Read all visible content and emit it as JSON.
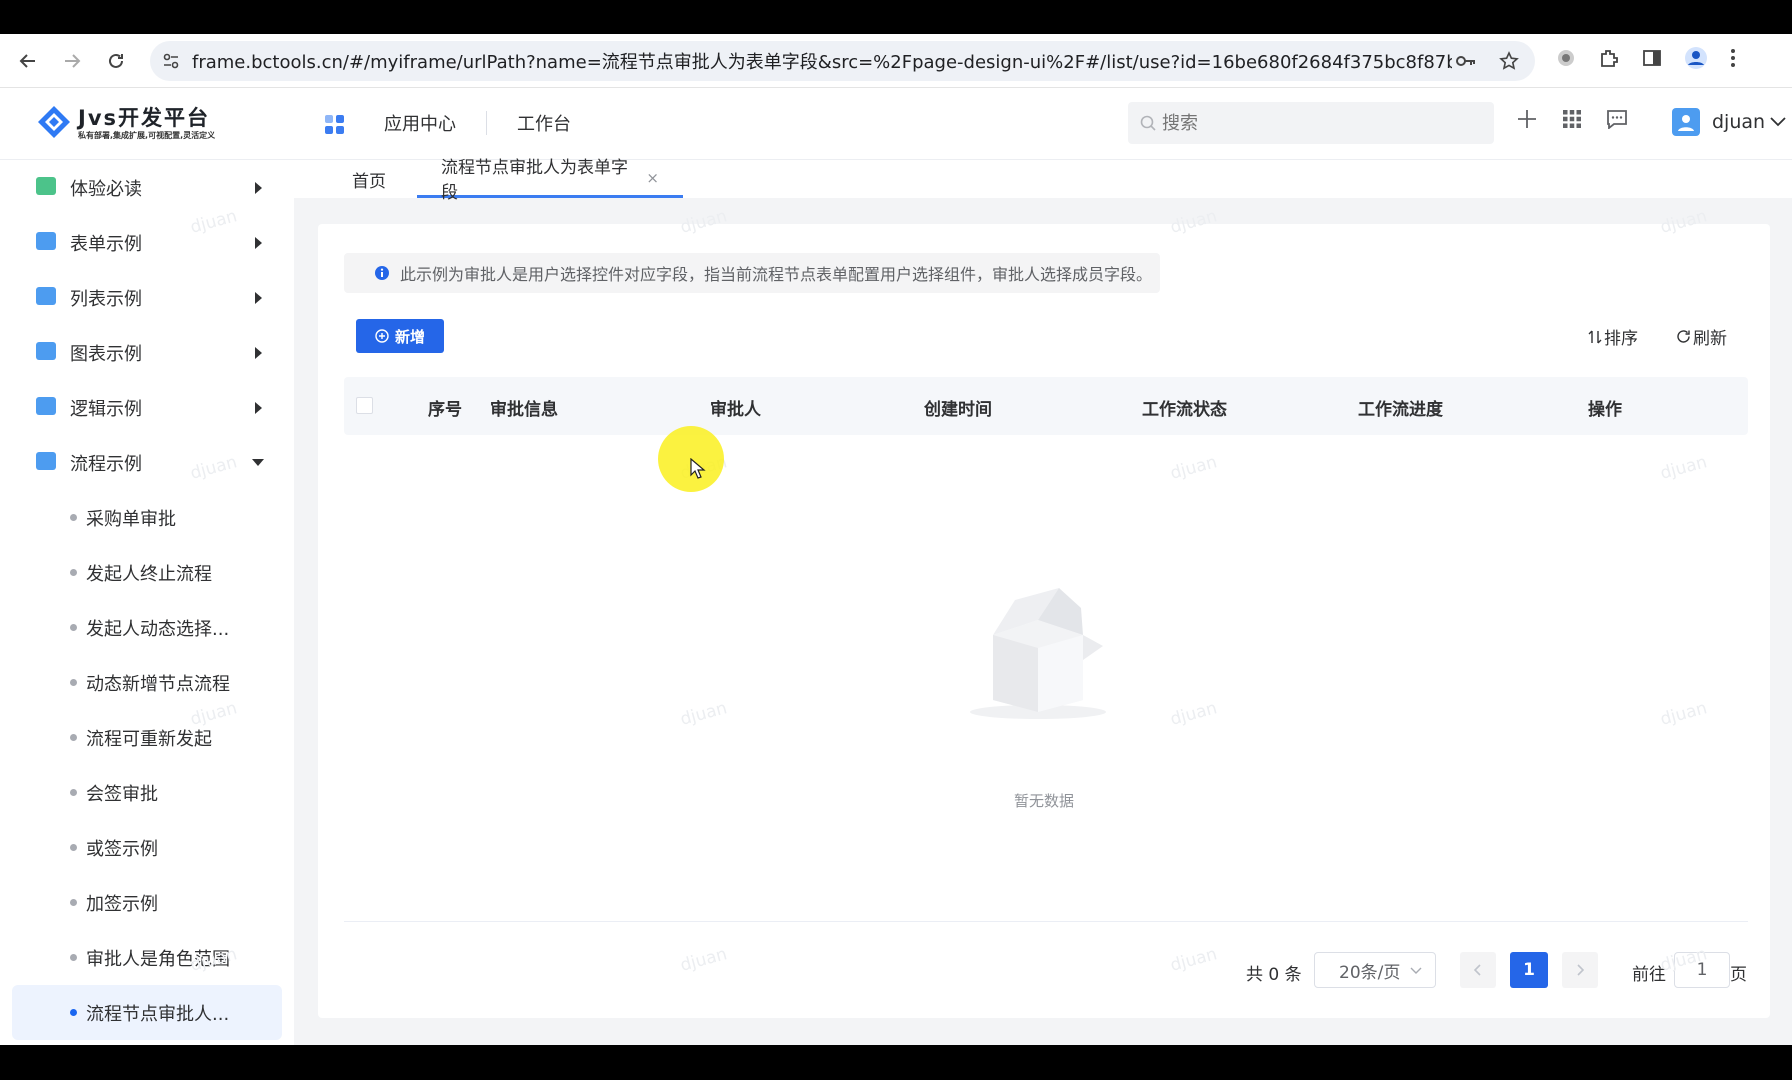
{
  "browser": {
    "url": "frame.bctools.cn/#/myiframe/urlPath?name=流程节点审批人为表单字段&src=%2Fpage-design-ui%2F#/list/use?id=16be680f2684f375bc8f87b04761d53..."
  },
  "header": {
    "logo_title": "Jvs开发平台",
    "logo_subtitle": "私有部署,集成扩展,可视配置,灵活定义",
    "nav": [
      "应用中心",
      "工作台"
    ],
    "search_placeholder": "搜索",
    "username": "djuan"
  },
  "sidebar": {
    "menus": [
      {
        "label": "体验必读",
        "icon_color": "#4cc38a",
        "expanded": false
      },
      {
        "label": "表单示例",
        "icon_color": "#4d9cf0",
        "expanded": false
      },
      {
        "label": "列表示例",
        "icon_color": "#4d9cf0",
        "expanded": false
      },
      {
        "label": "图表示例",
        "icon_color": "#4d9cf0",
        "expanded": false
      },
      {
        "label": "逻辑示例",
        "icon_color": "#4d9cf0",
        "expanded": false
      },
      {
        "label": "流程示例",
        "icon_color": "#4d9cf0",
        "expanded": true
      }
    ],
    "subitems": [
      "采购单审批",
      "发起人终止流程",
      "发起人动态选择...",
      "动态新增节点流程",
      "流程可重新发起",
      "会签审批",
      "或签示例",
      "加签示例",
      "审批人是角色范围",
      "流程节点审批人..."
    ],
    "active_subitem_index": 9
  },
  "tabs": [
    {
      "label": "首页",
      "active": false
    },
    {
      "label": "流程节点审批人为表单字段",
      "active": true,
      "close": "×"
    }
  ],
  "main": {
    "alert_text": "此示例为审批人是用户选择控件对应字段，指当前流程节点表单配置用户选择组件，审批人选择成员字段。",
    "add_button": "新增",
    "sort_button": "排序",
    "refresh_button": "刷新",
    "columns": [
      "序号",
      "审批信息",
      "审批人",
      "创建时间",
      "工作流状态",
      "工作流进度",
      "操作"
    ],
    "empty_text": "暂无数据",
    "pagination": {
      "total": "共 0 条",
      "page_size": "20条/页",
      "current_page": "1",
      "goto_label": "前往",
      "goto_value": "1",
      "page_unit": "页"
    },
    "watermark": "djuan"
  },
  "colors": {
    "primary": "#2566e8",
    "tab_underline": "#3b7cf1",
    "active_bg": "#edf3fe",
    "cursor_highlight": "#faf01e"
  }
}
